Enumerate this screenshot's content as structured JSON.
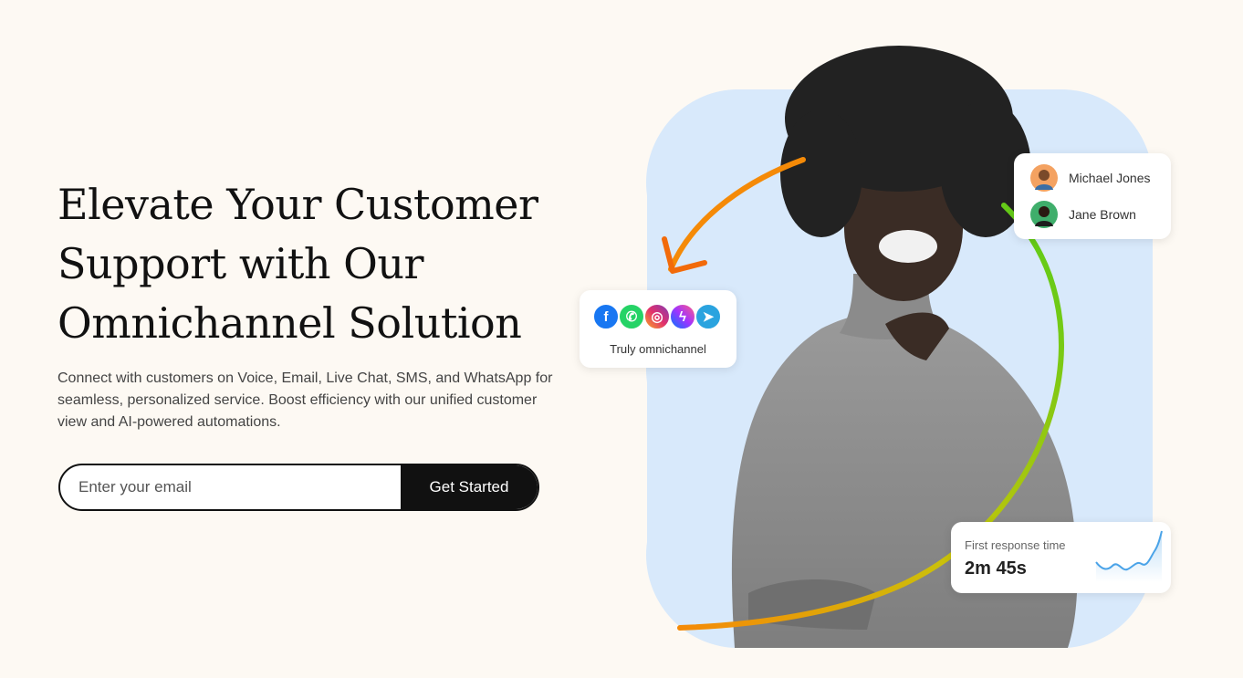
{
  "hero": {
    "title_lines": [
      "Elevate Your Customer",
      "Support with Our",
      "Omnichannel Solution"
    ],
    "description": "Connect with customers on Voice, Email, Live Chat, SMS, and WhatsApp for seamless, personalized service. Boost efficiency with our unified customer view and AI-powered automations."
  },
  "signup": {
    "email_placeholder": "Enter your email",
    "button_label": "Get Started"
  },
  "channels_card": {
    "icons": [
      "facebook-icon",
      "whatsapp-icon",
      "instagram-icon",
      "messenger-icon",
      "telegram-icon"
    ],
    "label": "Truly omnichannel"
  },
  "agents_card": {
    "agents": [
      {
        "name": "Michael Jones"
      },
      {
        "name": "Jane Brown"
      }
    ]
  },
  "metric_card": {
    "label": "First response time",
    "value": "2m 45s"
  },
  "colors": {
    "background": "#fdf9f3",
    "blob": "#d8e9fb",
    "arc_orange": "#f58a07",
    "arc_green": "#66cc1a",
    "button": "#111111",
    "sparkline": "#4aa3e8"
  }
}
